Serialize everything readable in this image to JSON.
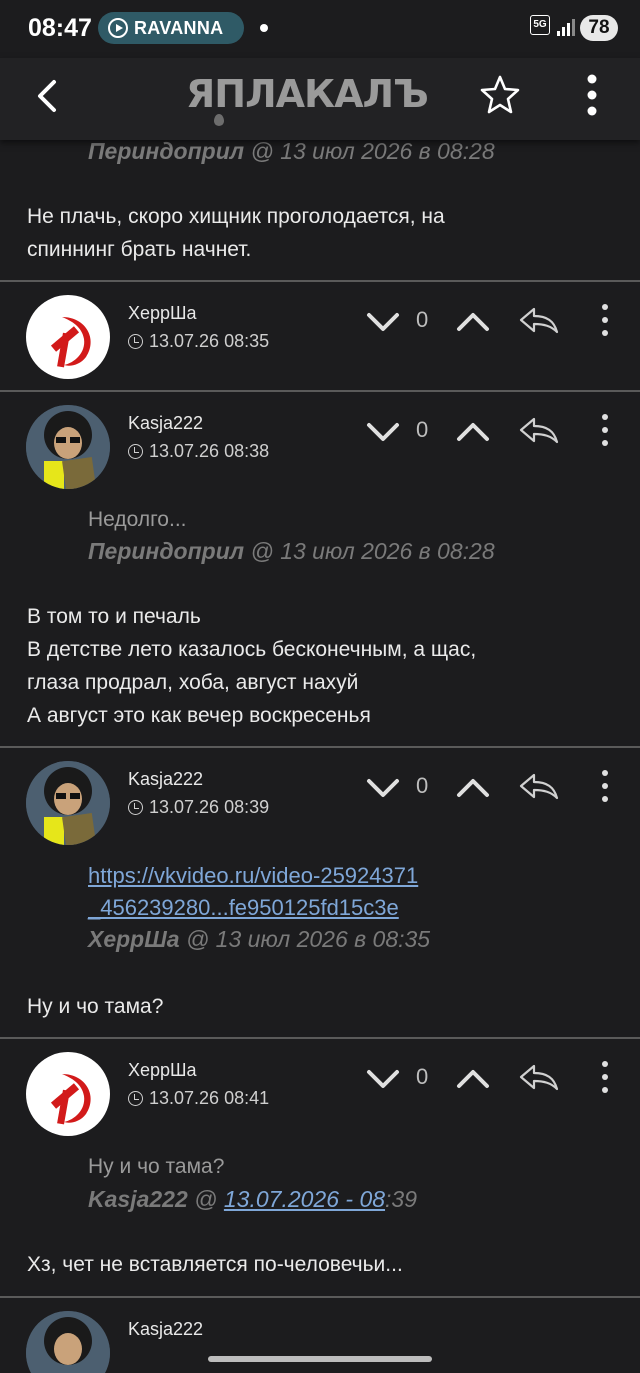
{
  "status_bar": {
    "time": "08:47",
    "media_app": "RAVANNA",
    "network": "5G",
    "battery": "78"
  },
  "app_bar": {
    "logo": "ЯПЛАКАЛЪ",
    "icons": [
      "back-arrow-icon",
      "star-icon",
      "more-vert-icon"
    ]
  },
  "comments": [
    {
      "quote_author": "Периндоприл",
      "quote_meta": "@ 13 июл 2026 в 08:28",
      "body": [
        "Не плачь, скоро хищник проголодается, на",
        "спиннинг брать начнет."
      ]
    },
    {
      "user": "ХеррШа",
      "date": "13.07.26 08:35",
      "score": "0",
      "avatar": "hammer-sickle"
    },
    {
      "user": "Kasja222",
      "date": "13.07.26 08:38",
      "score": "0",
      "avatar": "cartoon-girl",
      "quote_text": "Недолго...",
      "quote_author": "Периндоприл",
      "quote_meta": "@ 13 июл 2026 в 08:28",
      "body": [
        "В том то и печаль",
        "В детстве лето казалось бесконечным, а щас,",
        "глаза продрал, хоба, август нахуй",
        "А август это как вечер воскресенья"
      ]
    },
    {
      "user": "Kasja222",
      "date": "13.07.26 08:39",
      "score": "0",
      "avatar": "cartoon-girl",
      "quote_link": [
        "https://vkvideo.ru/video-25924371",
        "_456239280...fe950125fd15c3e"
      ],
      "quote_author": "ХеррШа",
      "quote_meta": "@ 13 июл 2026 в 08:35",
      "body": [
        "Ну и чо тама?"
      ]
    },
    {
      "user": "ХеррШа",
      "date": "13.07.26 08:41",
      "score": "0",
      "avatar": "hammer-sickle",
      "quote_text": "Ну и чо тама?",
      "quote_author": "Kasja222",
      "quote_at": "@",
      "quote_date_link": "13.07.2026 - 08",
      "quote_date_rest": ":39",
      "body": [
        "Хз, чет не вставляется по-человечьи..."
      ]
    },
    {
      "user": "Kasja222",
      "avatar": "cartoon-girl"
    }
  ],
  "colors": {
    "background": "#1c1c1e",
    "divider": "#5a5a5a",
    "link": "#7fa7d8",
    "avatar_red": "#d21a1a"
  }
}
